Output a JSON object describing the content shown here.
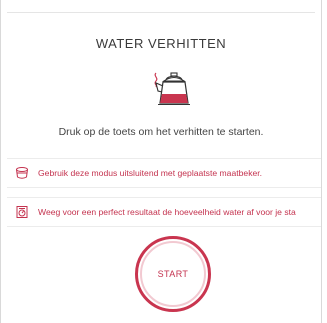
{
  "screen": {
    "title": "WATER VERHITTEN",
    "instruction": "Druk op de toets om het verhitten te starten."
  },
  "notices": [
    {
      "icon": "measuring-cup-icon",
      "text": "Gebruik deze modus uitsluitend met geplaatste maatbeker."
    },
    {
      "icon": "scale-icon",
      "text": "Weeg voor een perfect resultaat de hoeveelheid water af voor je sta"
    }
  ],
  "start_button": {
    "label": "START"
  },
  "colors": {
    "accent": "#c9354f",
    "accent_light": "#f2c9d1",
    "text": "#333333"
  }
}
